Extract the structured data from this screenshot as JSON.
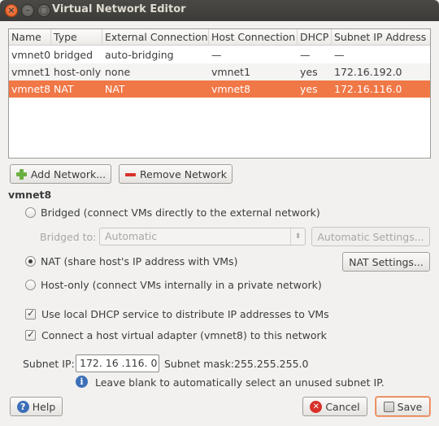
{
  "window": {
    "title": "Virtual Network Editor"
  },
  "table": {
    "columns": [
      "Name",
      "Type",
      "External Connection",
      "Host Connection",
      "DHCP",
      "Subnet IP Address"
    ],
    "rows": [
      [
        "vmnet0",
        "bridged",
        "auto-bridging",
        "—",
        "—",
        "—"
      ],
      [
        "vmnet1",
        "host-only",
        "none",
        "vmnet1",
        "yes",
        "172.16.192.0"
      ],
      [
        "vmnet8",
        "NAT",
        "NAT",
        "vmnet8",
        "yes",
        "172.16.116.0"
      ]
    ],
    "selected_row": 2
  },
  "toolbar": {
    "add_label": "Add Network...",
    "remove_label": "Remove Network"
  },
  "details": {
    "section_title": "vmnet8",
    "bridged_label": "Bridged (connect VMs directly to the external network)",
    "bridged_to_label": "Bridged to:",
    "bridged_to_value": "Automatic",
    "auto_settings_label": "Automatic Settings...",
    "nat_label": "NAT (share host's IP address with VMs)",
    "nat_settings_label": "NAT Settings...",
    "hostonly_label": "Host-only (connect VMs internally in a private network)",
    "selected_mode": "nat",
    "dhcp_label": "Use local DHCP service to distribute IP addresses to VMs",
    "dhcp_checked": true,
    "adapter_label": "Connect a host virtual adapter (vmnet8) to this network",
    "adapter_checked": true,
    "subnet_ip_label": "Subnet IP:",
    "subnet_ip_value": "172. 16 .116.  0",
    "subnet_mask_label": "Subnet mask:",
    "subnet_mask_value": "255.255.255.0",
    "hint": "Leave blank to automatically select an unused subnet IP."
  },
  "footer": {
    "help_label": "Help",
    "cancel_label": "Cancel",
    "save_label": "Save"
  },
  "colors": {
    "accent": "#f07746",
    "titlebar": "#3c3b37"
  }
}
